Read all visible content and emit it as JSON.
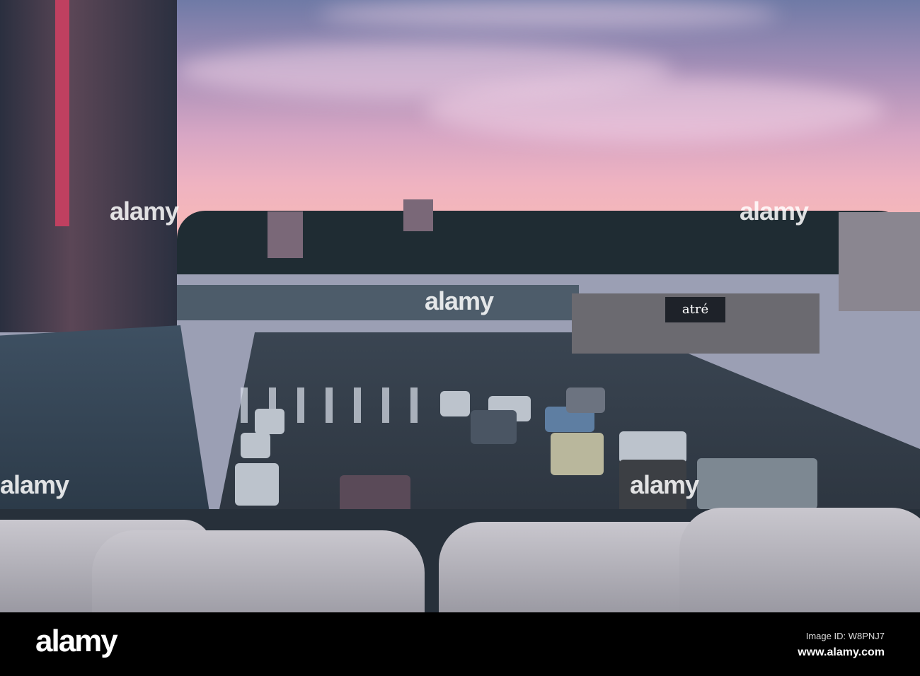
{
  "photo": {
    "sign_text": "atré",
    "watermark": "alamy"
  },
  "footer": {
    "logo": "alamy",
    "image_id": "Image ID: W8PNJ7",
    "website": "www.alamy.com"
  }
}
